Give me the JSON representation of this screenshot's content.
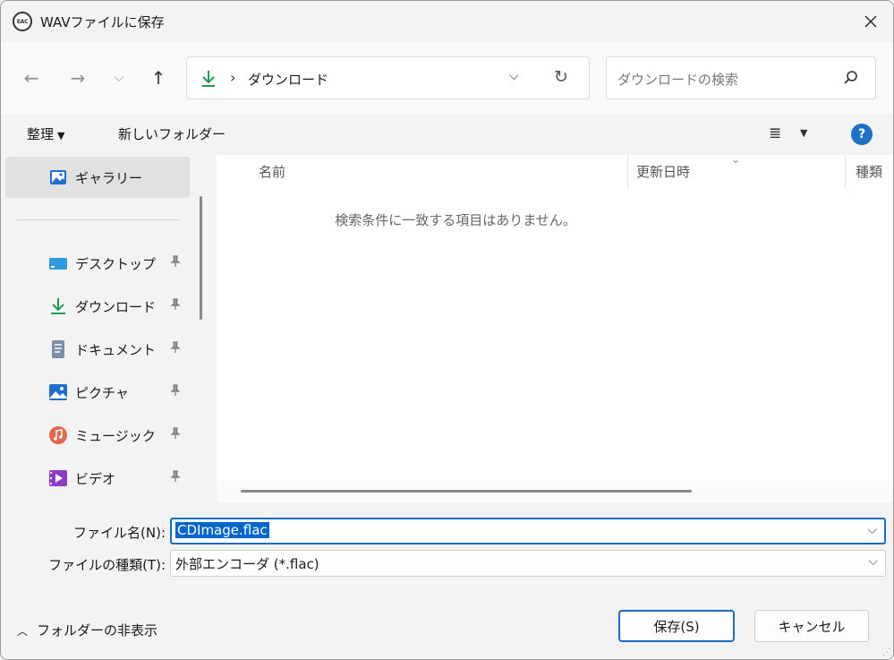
{
  "window": {
    "title": "WAVファイルに保存",
    "app_icon_text": "EAC",
    "close_icon": "close-icon"
  },
  "nav": {
    "back_icon": "←",
    "forward_icon": "→",
    "recent_icon": "⌵",
    "up_icon": "↑",
    "address_path": "ダウンロード",
    "address_separator": "›",
    "address_dropdown": "⌵",
    "refresh_icon": "↻",
    "search_placeholder": "ダウンロードの検索",
    "search_icon": "⚲"
  },
  "toolbar": {
    "organize_label": "整理",
    "organize_caret": "▼",
    "new_folder_label": "新しいフォルダー",
    "view_icon": "≣",
    "view_caret": "▼",
    "help_label": "?"
  },
  "sidebar": {
    "gallery_label": "ギャラリー",
    "pin_icon": "📌",
    "items": [
      {
        "label": "デスクトップ",
        "icon": "desktop-icon"
      },
      {
        "label": "ダウンロード",
        "icon": "download-icon"
      },
      {
        "label": "ドキュメント",
        "icon": "document-icon"
      },
      {
        "label": "ピクチャ",
        "icon": "pictures-icon"
      },
      {
        "label": "ミュージック",
        "icon": "music-icon"
      },
      {
        "label": "ビデオ",
        "icon": "video-icon"
      }
    ]
  },
  "filelist": {
    "columns": [
      "名前",
      "更新日時",
      "種類"
    ],
    "sort_indicator": "⌄",
    "empty_message": "検索条件に一致する項目はありません。"
  },
  "form": {
    "filename_label": "ファイル名(N):",
    "filename_value": "CDImage.flac",
    "filetype_label": "ファイルの種類(T):",
    "filetype_value": "外部エンコーダ (*.flac)",
    "dropdown_icon": "⌵"
  },
  "footer": {
    "toggle_chevron": "︿",
    "toggle_label": "フォルダーの非表示",
    "save_label": "保存(S)",
    "cancel_label": "キャンセル",
    "grip": "⋰"
  },
  "colors": {
    "accent": "#1b6bc6",
    "selection": "#0066cc",
    "download_green": "#1e9a54"
  }
}
